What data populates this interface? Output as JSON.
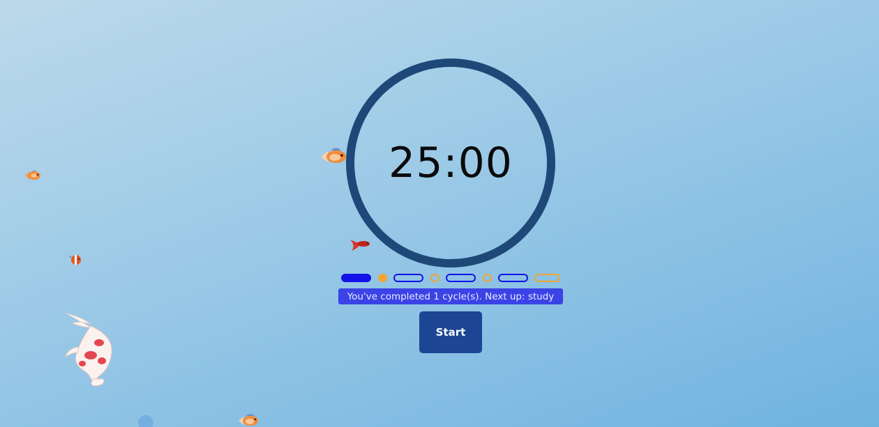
{
  "timer": {
    "display": "25:00",
    "ring_color": "#1d4877"
  },
  "progress": {
    "segments": [
      {
        "kind": "study",
        "state": "completed"
      },
      {
        "kind": "break",
        "state": "completed"
      },
      {
        "kind": "study",
        "state": "pending"
      },
      {
        "kind": "break",
        "state": "pending"
      },
      {
        "kind": "study",
        "state": "pending"
      },
      {
        "kind": "break",
        "state": "pending"
      },
      {
        "kind": "study",
        "state": "pending"
      },
      {
        "kind": "long-break",
        "state": "pending"
      }
    ],
    "study_color": "#1212e8",
    "break_color": "#f2a530"
  },
  "status": {
    "message": "You've completed 1 cycle(s). Next up: study"
  },
  "controls": {
    "start_label": "Start"
  },
  "decorations": {
    "icons": [
      "goldfish-icon",
      "betta-fish-icon",
      "koi-fish-icon",
      "clownfish-icon"
    ]
  }
}
